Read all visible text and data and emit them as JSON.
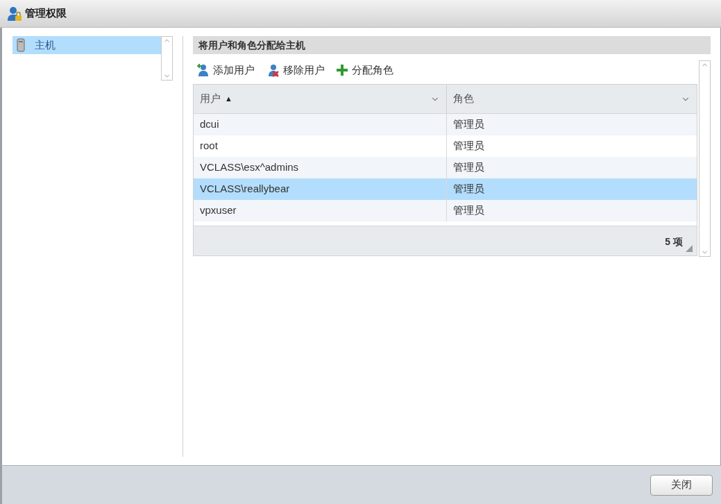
{
  "window": {
    "title": "管理权限"
  },
  "tree": {
    "items": [
      {
        "label": "主机",
        "selected": true
      }
    ]
  },
  "section": {
    "title": "将用户和角色分配给主机"
  },
  "toolbar": [
    {
      "kind": "add-user",
      "label": "添加用户"
    },
    {
      "kind": "remove-user",
      "label": "移除用户"
    },
    {
      "kind": "assign",
      "label": "分配角色"
    }
  ],
  "table": {
    "columns": [
      {
        "label": "用户",
        "sort": "▲"
      },
      {
        "label": "角色"
      }
    ],
    "rows": [
      {
        "user": "dcui",
        "role": "管理员",
        "selected": false
      },
      {
        "user": "root",
        "role": "管理员",
        "selected": false
      },
      {
        "user": "VCLASS\\esx^admins",
        "role": "管理员",
        "selected": false
      },
      {
        "user": "VCLASS\\reallybear",
        "role": "管理员",
        "selected": true
      },
      {
        "user": "vpxuser",
        "role": "管理员",
        "selected": false
      }
    ],
    "count": "5 项"
  },
  "buttons": [
    "关闭"
  ]
}
